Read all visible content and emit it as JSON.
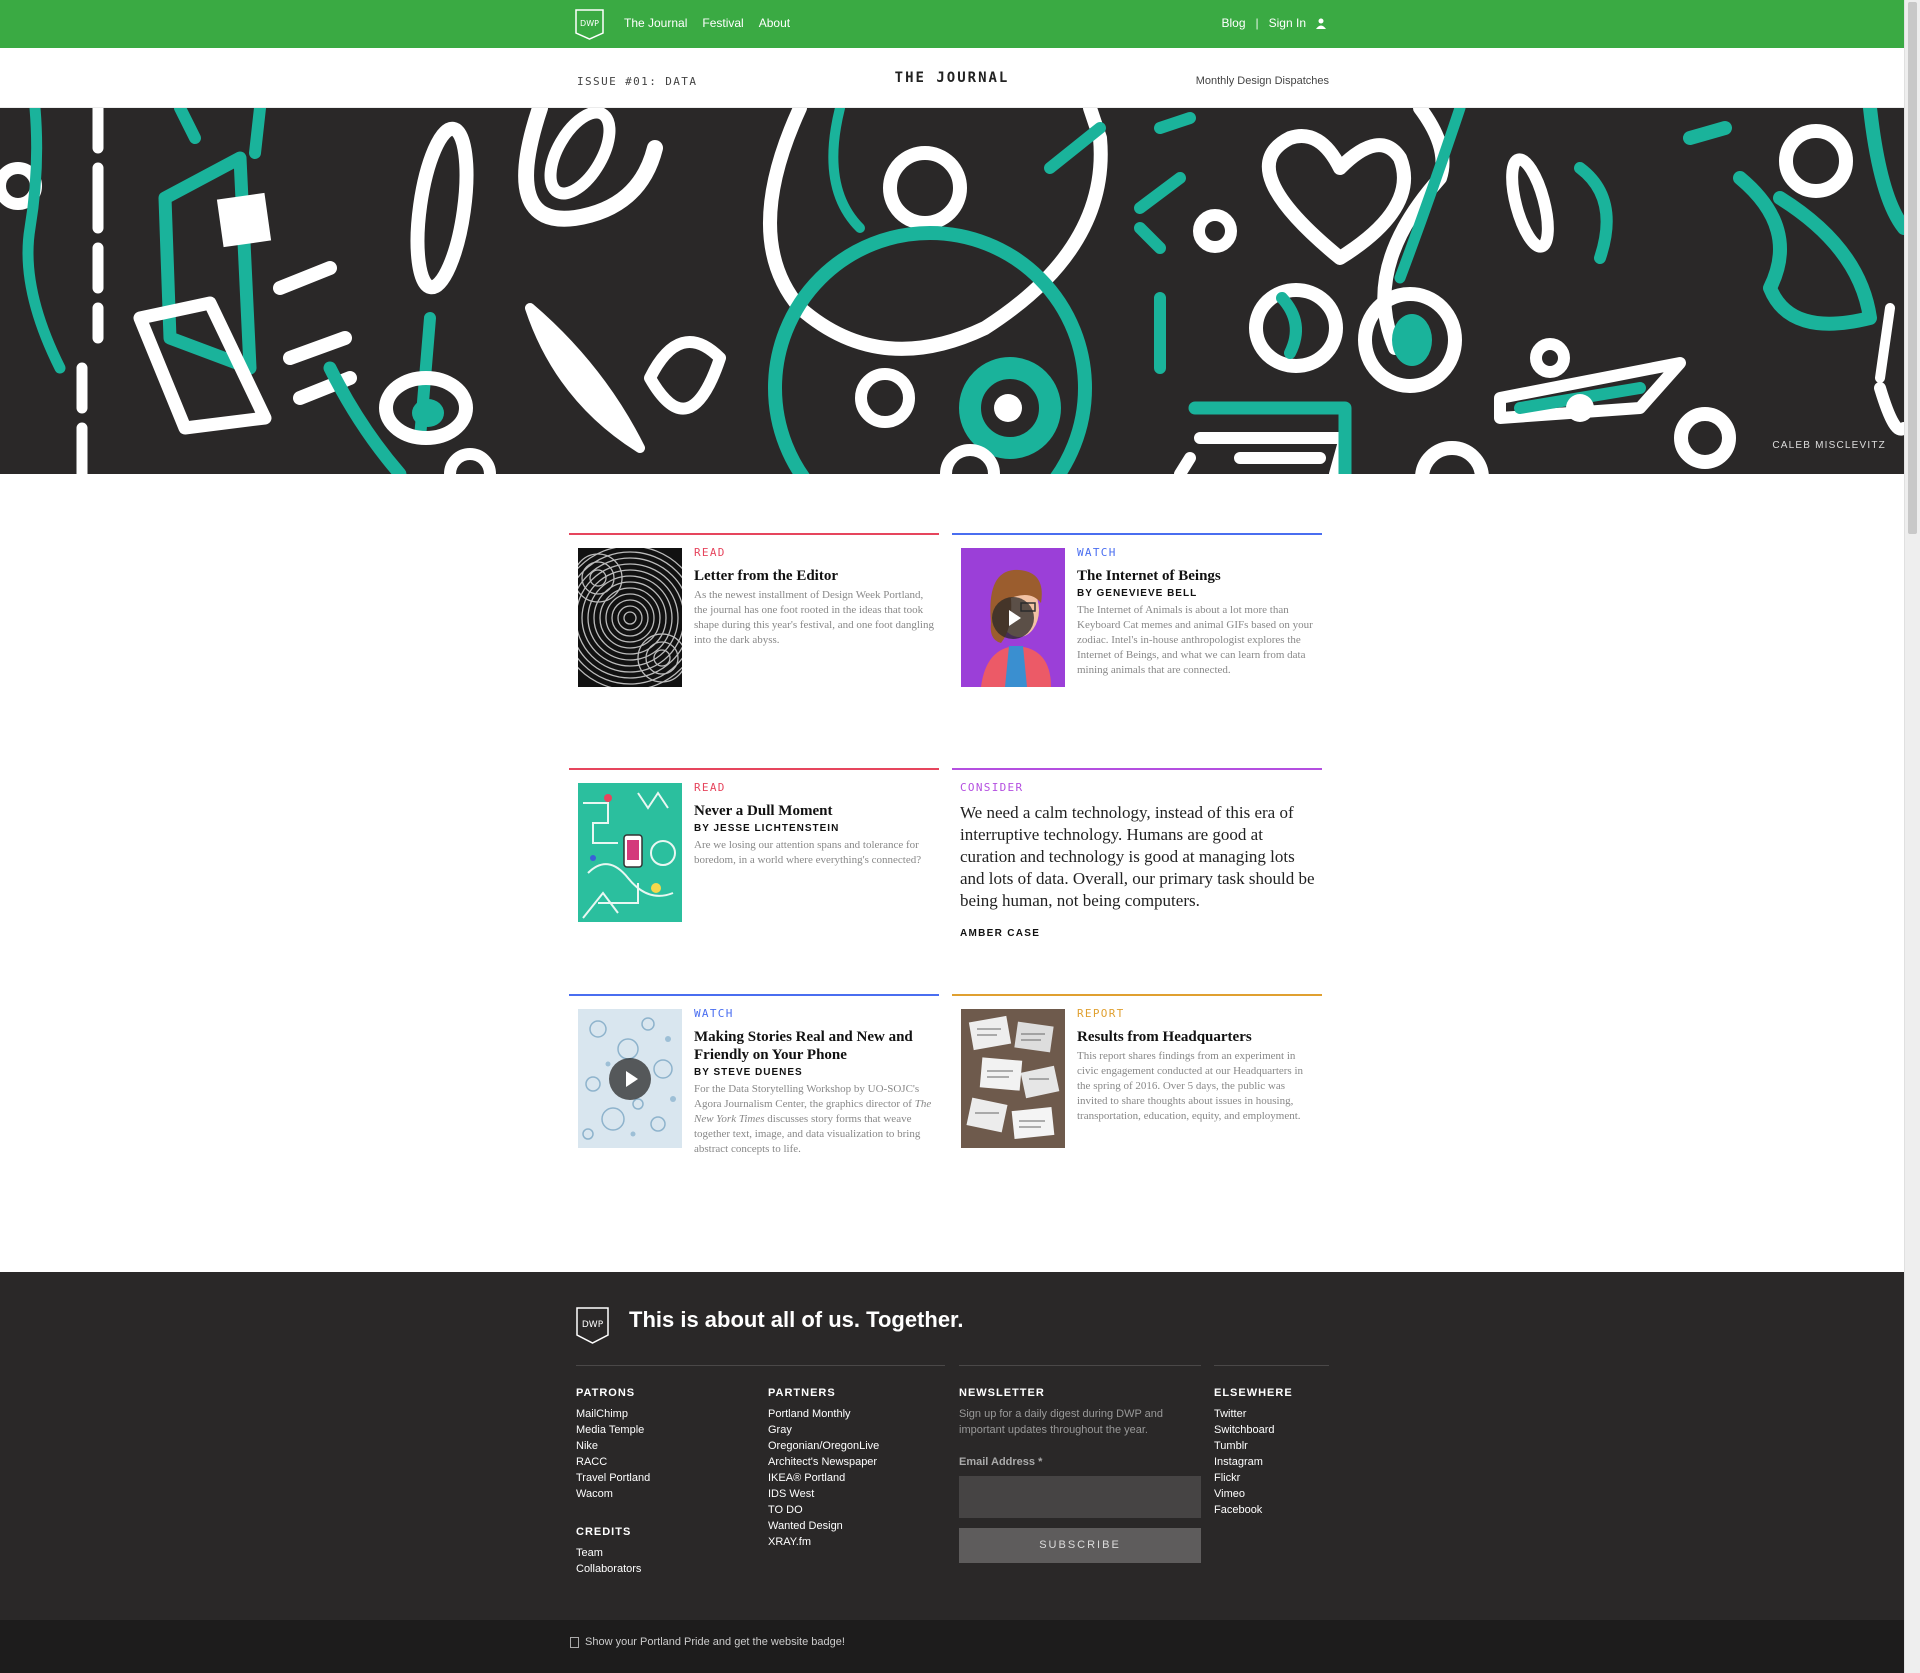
{
  "nav": {
    "logo": "DWP",
    "left_items": [
      "The Journal",
      "Festival",
      "About"
    ],
    "blog": "Blog",
    "separator": "|",
    "signin": "Sign In",
    "color": "#3aaa43"
  },
  "header": {
    "issue": "ISSUE #01: DATA",
    "title": "THE JOURNAL",
    "tagline": "Monthly Design Dispatches"
  },
  "hero": {
    "credit": "CALEB MISCLEVITZ",
    "colors": {
      "bg": "#2a2828",
      "teal": "#1ab39b",
      "white": "#ffffff"
    }
  },
  "articles": [
    {
      "kind": "READ",
      "color": "#e6455d",
      "title": "Letter from the Editor",
      "byline": "",
      "description": "As the newest installment of Design Week Portland, the journal has one foot rooted in the ideas that took shape during this year's festival, and one foot dangling into the dark abyss."
    },
    {
      "kind": "WATCH",
      "color": "#4a6ef0",
      "title": "The Internet of Beings",
      "byline": "BY GENEVIEVE BELL",
      "description": "The Internet of Animals is about a lot more than Keyboard Cat memes and animal GIFs based on your zodiac. Intel's in-house anthropologist explores the Internet of Beings, and what we can learn from data mining animals that are connected."
    },
    {
      "kind": "READ",
      "color": "#e6455d",
      "title": "Never a Dull Moment",
      "byline": "BY JESSE LICHTENSTEIN",
      "description": "Are we losing our attention spans and tolerance for boredom, in a world where everything's connected?"
    },
    {
      "kind": "CONSIDER",
      "color": "#b44fe0",
      "quote": "We need a calm technology, instead of this era of interruptive technology. Humans are good at curation and technology is good at managing lots and lots of data. Overall, our primary task should be being human, not being computers.",
      "author": "AMBER CASE"
    },
    {
      "kind": "WATCH",
      "color": "#4a6ef0",
      "title": "Making Stories Real and New and Friendly on Your Phone",
      "byline": "BY STEVE DUENES",
      "description_before": "For the Data Storytelling Workshop by UO-SOJC's Agora Journalism Center, the graphics director of ",
      "description_em": "The New York Times",
      "description_after": " discusses story forms that weave together text, image, and data visualization to bring abstract concepts to life."
    },
    {
      "kind": "REPORT",
      "color": "#e0a030",
      "title": "Results from Headquarters",
      "byline": "",
      "description": "This report shares findings from an experiment in civic engagement conducted at our Headquarters in the spring of 2016. Over 5 days, the public was invited to share thoughts about issues in housing, transportation, education, equity, and employment."
    }
  ],
  "footer": {
    "tagline": "This is about all of us. Together.",
    "patrons": {
      "heading": "PATRONS",
      "items": [
        "MailChimp",
        "Media Temple",
        "Nike",
        "RACC",
        "Travel Portland",
        "Wacom"
      ]
    },
    "credits": {
      "heading": "CREDITS",
      "items": [
        "Team",
        "Collaborators"
      ]
    },
    "partners": {
      "heading": "PARTNERS",
      "items": [
        "Portland Monthly",
        "Gray",
        "Oregonian/OregonLive",
        "Architect's Newspaper",
        "IKEA® Portland",
        "IDS West",
        "TO DO",
        "Wanted Design",
        "XRAY.fm"
      ]
    },
    "newsletter": {
      "heading": "NEWSLETTER",
      "text": "Sign up for a daily digest during DWP and important updates throughout the year.",
      "email_label": "Email Address *",
      "email_value": "",
      "button": "SUBSCRIBE"
    },
    "elsewhere": {
      "heading": "ELSEWHERE",
      "items": [
        "Twitter",
        "Switchboard",
        "Tumblr",
        "Instagram",
        "Flickr",
        "Vimeo",
        "Facebook"
      ]
    },
    "badge_text": "Show your Portland Pride and get the website badge!"
  }
}
